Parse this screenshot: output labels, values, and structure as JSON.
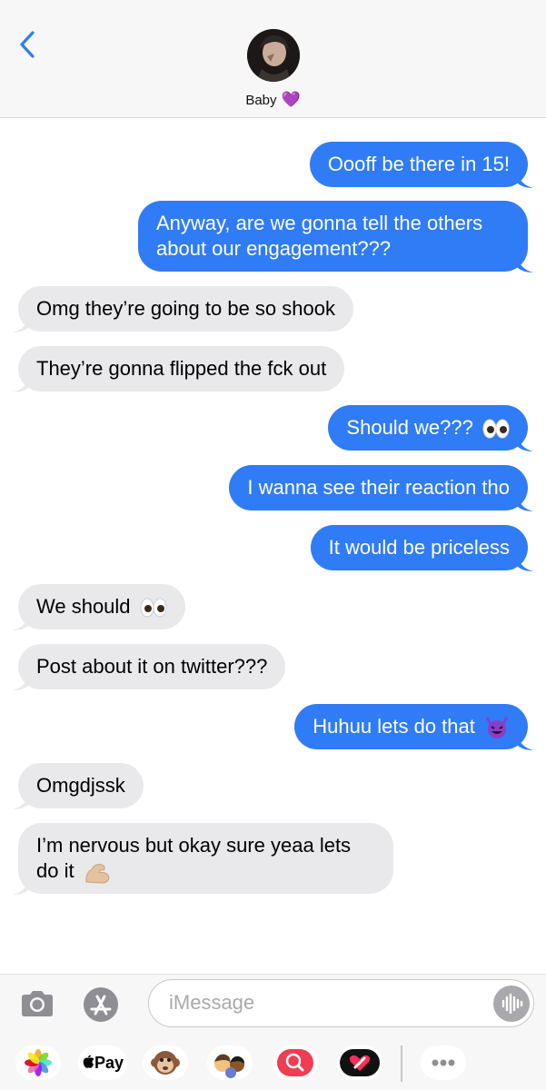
{
  "header": {
    "contact_name": "Baby",
    "name_emoji": "💜"
  },
  "messages": [
    {
      "side": "sent",
      "text": "Oooff be there in 15!"
    },
    {
      "side": "sent",
      "text": "Anyway, are we gonna tell the others about our engagement???"
    },
    {
      "side": "recv",
      "text": "Omg they’re going to be so shook"
    },
    {
      "side": "recv",
      "text": "They’re gonna flipped the fck out"
    },
    {
      "side": "sent",
      "text": "Should we???",
      "emoji": "eyes"
    },
    {
      "side": "sent",
      "text": "I wanna see their reaction tho"
    },
    {
      "side": "sent",
      "text": "It would be priceless"
    },
    {
      "side": "recv",
      "text": "We should",
      "emoji": "eyes"
    },
    {
      "side": "recv",
      "text": "Post about it on twitter???"
    },
    {
      "side": "sent",
      "text": "Huhuu lets do that",
      "emoji": "devil"
    },
    {
      "side": "recv",
      "text": "Omgdjssk"
    },
    {
      "side": "recv",
      "text": "I’m nervous but okay sure yeaa lets do it",
      "emoji": "muscle"
    }
  ],
  "input": {
    "placeholder": "iMessage"
  },
  "tray": {
    "apple_pay_label": "Pay"
  },
  "colors": {
    "sent_bubble": "#2f7cf6",
    "recv_bubble": "#e9e9eb",
    "accent": "#2f7cf6"
  },
  "icons": [
    "back-chevron-icon",
    "camera-icon",
    "app-store-icon",
    "audio-waveform-icon",
    "photos-icon",
    "apple-logo-icon",
    "monkey-memoji-icon",
    "memoji-stickers-icon",
    "web-search-icon",
    "digital-touch-icon",
    "more-icon"
  ]
}
